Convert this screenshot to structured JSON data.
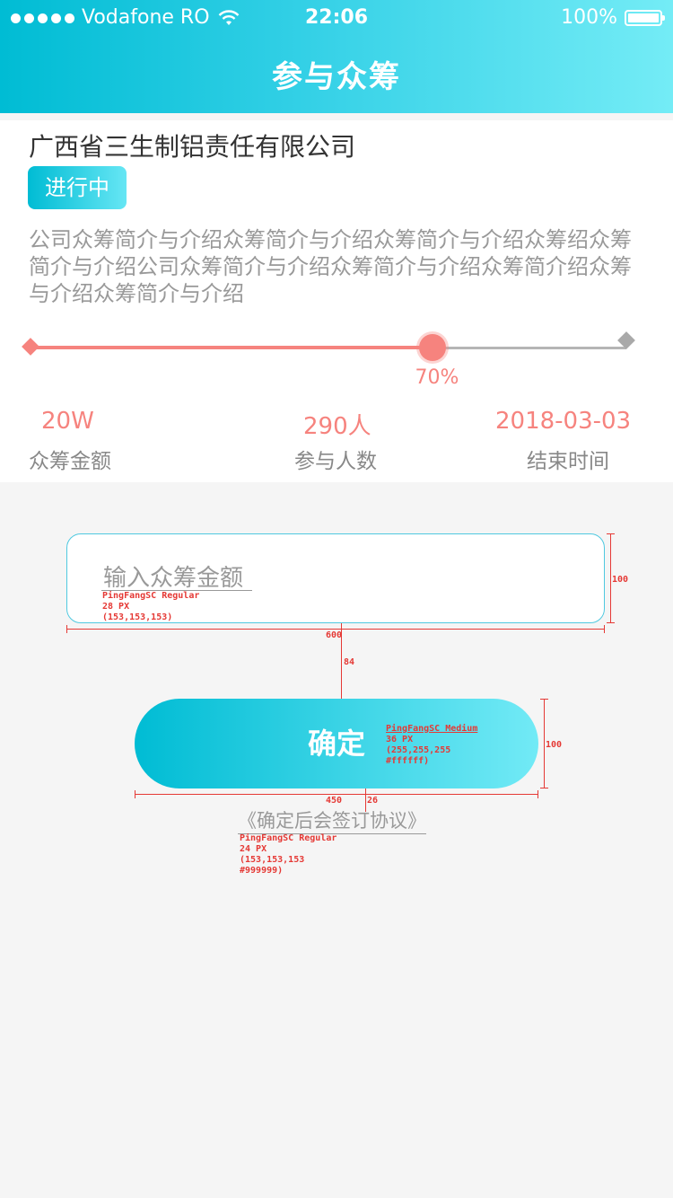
{
  "status_bar": {
    "carrier": "Vodafone RO",
    "time": "22:06",
    "battery": "100%"
  },
  "nav": {
    "title": "参与众筹"
  },
  "project": {
    "company": "广西省三生制铝责任有限公司",
    "status": "进行中",
    "description": "公司众筹简介与介绍众筹简介与介绍众筹简介与介绍众筹绍众筹简介与介绍公司众筹简介与介绍众筹简介与介绍众筹简介绍众筹与介绍众筹简介与介绍",
    "progress_label": "70%",
    "progress_fraction": 0.7,
    "stats": [
      {
        "value": "20W",
        "label": "众筹金额"
      },
      {
        "value": "290人",
        "label": "参与人数"
      },
      {
        "value": "2018-03-03",
        "label": "结束时间"
      }
    ]
  },
  "form": {
    "amount_placeholder": "输入众筹金额",
    "confirm_label": "确定",
    "agreement_text": "《确定后会签订协议》"
  },
  "annotations": {
    "input_font": "PingFangSC Regular",
    "input_size": "28 PX",
    "input_color": "(153,153,153)",
    "input_height": "100",
    "input_width": "600",
    "gap": "84",
    "button_font": "PingFangSC Medium",
    "button_size": "36 PX",
    "button_color": "(255,255,255",
    "button_hex": "#ffffff)",
    "button_height": "100",
    "button_width": "450",
    "agreement_gap": "26",
    "agreement_font": "PingFangSC Regular",
    "agreement_size": "24 PX",
    "agreement_color": "(153,153,153",
    "agreement_hex": "#999999)"
  },
  "colors": {
    "accent": "#00bcd4",
    "progress": "#f6837e",
    "annotation": "#e53935"
  }
}
